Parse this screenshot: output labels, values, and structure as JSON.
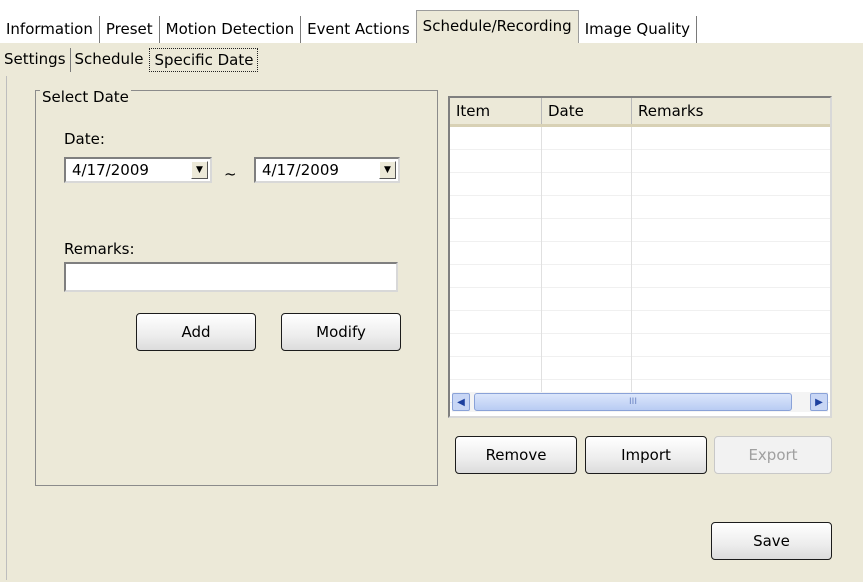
{
  "top_tabs": [
    {
      "label": "Information",
      "active": false
    },
    {
      "label": "Preset",
      "active": false
    },
    {
      "label": "Motion Detection",
      "active": false
    },
    {
      "label": "Event Actions",
      "active": false
    },
    {
      "label": "Schedule/Recording",
      "active": true
    },
    {
      "label": "Image Quality",
      "active": false
    }
  ],
  "sub_tabs": [
    {
      "label": "Settings",
      "active": false
    },
    {
      "label": "Schedule",
      "active": false
    },
    {
      "label": "Specific Date",
      "active": true
    }
  ],
  "select_date": {
    "group_label": "Select Date",
    "date_label": "Date:",
    "date_from": "4/17/2009",
    "separator": "~",
    "date_to": "4/17/2009",
    "remarks_label": "Remarks:",
    "remarks_value": "",
    "add_label": "Add",
    "modify_label": "Modify"
  },
  "table": {
    "columns": [
      "Item",
      "Date",
      "Remarks"
    ],
    "rows": [],
    "empty_row_count": 12,
    "scrollbar_grip": "III"
  },
  "actions": {
    "remove_label": "Remove",
    "import_label": "Import",
    "export_label": "Export",
    "export_enabled": false,
    "save_label": "Save"
  }
}
